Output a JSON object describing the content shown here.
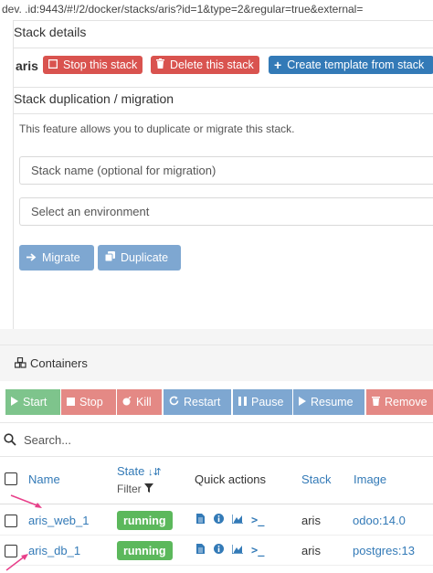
{
  "url_bar": {
    "text": "dev.          .id:9443/#!/2/docker/stacks/aris?id=1&type=2&regular=true&external="
  },
  "stack_details": {
    "title": "Stack details",
    "stack_name": "aris",
    "stop_label": "Stop this stack",
    "delete_label": "Delete this stack",
    "create_template_label": "Create template from stack"
  },
  "duplication": {
    "title": "Stack duplication / migration",
    "description": "This feature allows you to duplicate or migrate this stack.",
    "stack_name_placeholder": "Stack name (optional for migration)",
    "environment_placeholder": "Select an environment",
    "migrate_label": "Migrate",
    "duplicate_label": "Duplicate"
  },
  "containers": {
    "title": "Containers",
    "actions": {
      "start": "Start",
      "stop": "Stop",
      "kill": "Kill",
      "restart": "Restart",
      "pause": "Pause",
      "resume": "Resume",
      "remove": "Remove"
    },
    "search_placeholder": "Search...",
    "columns": {
      "name": "Name",
      "state": "State",
      "filter": "Filter",
      "quick_actions": "Quick actions",
      "stack": "Stack",
      "image": "Image"
    },
    "rows": [
      {
        "name": "aris_web_1",
        "state": "running",
        "stack": "aris",
        "image": "odoo:14.0"
      },
      {
        "name": "aris_db_1",
        "state": "running",
        "stack": "aris",
        "image": "postgres:13"
      }
    ]
  },
  "colors": {
    "danger": "#d9534f",
    "primary": "#337ab7",
    "success": "#5cb85c",
    "annotation_arrow": "#e8408a"
  }
}
